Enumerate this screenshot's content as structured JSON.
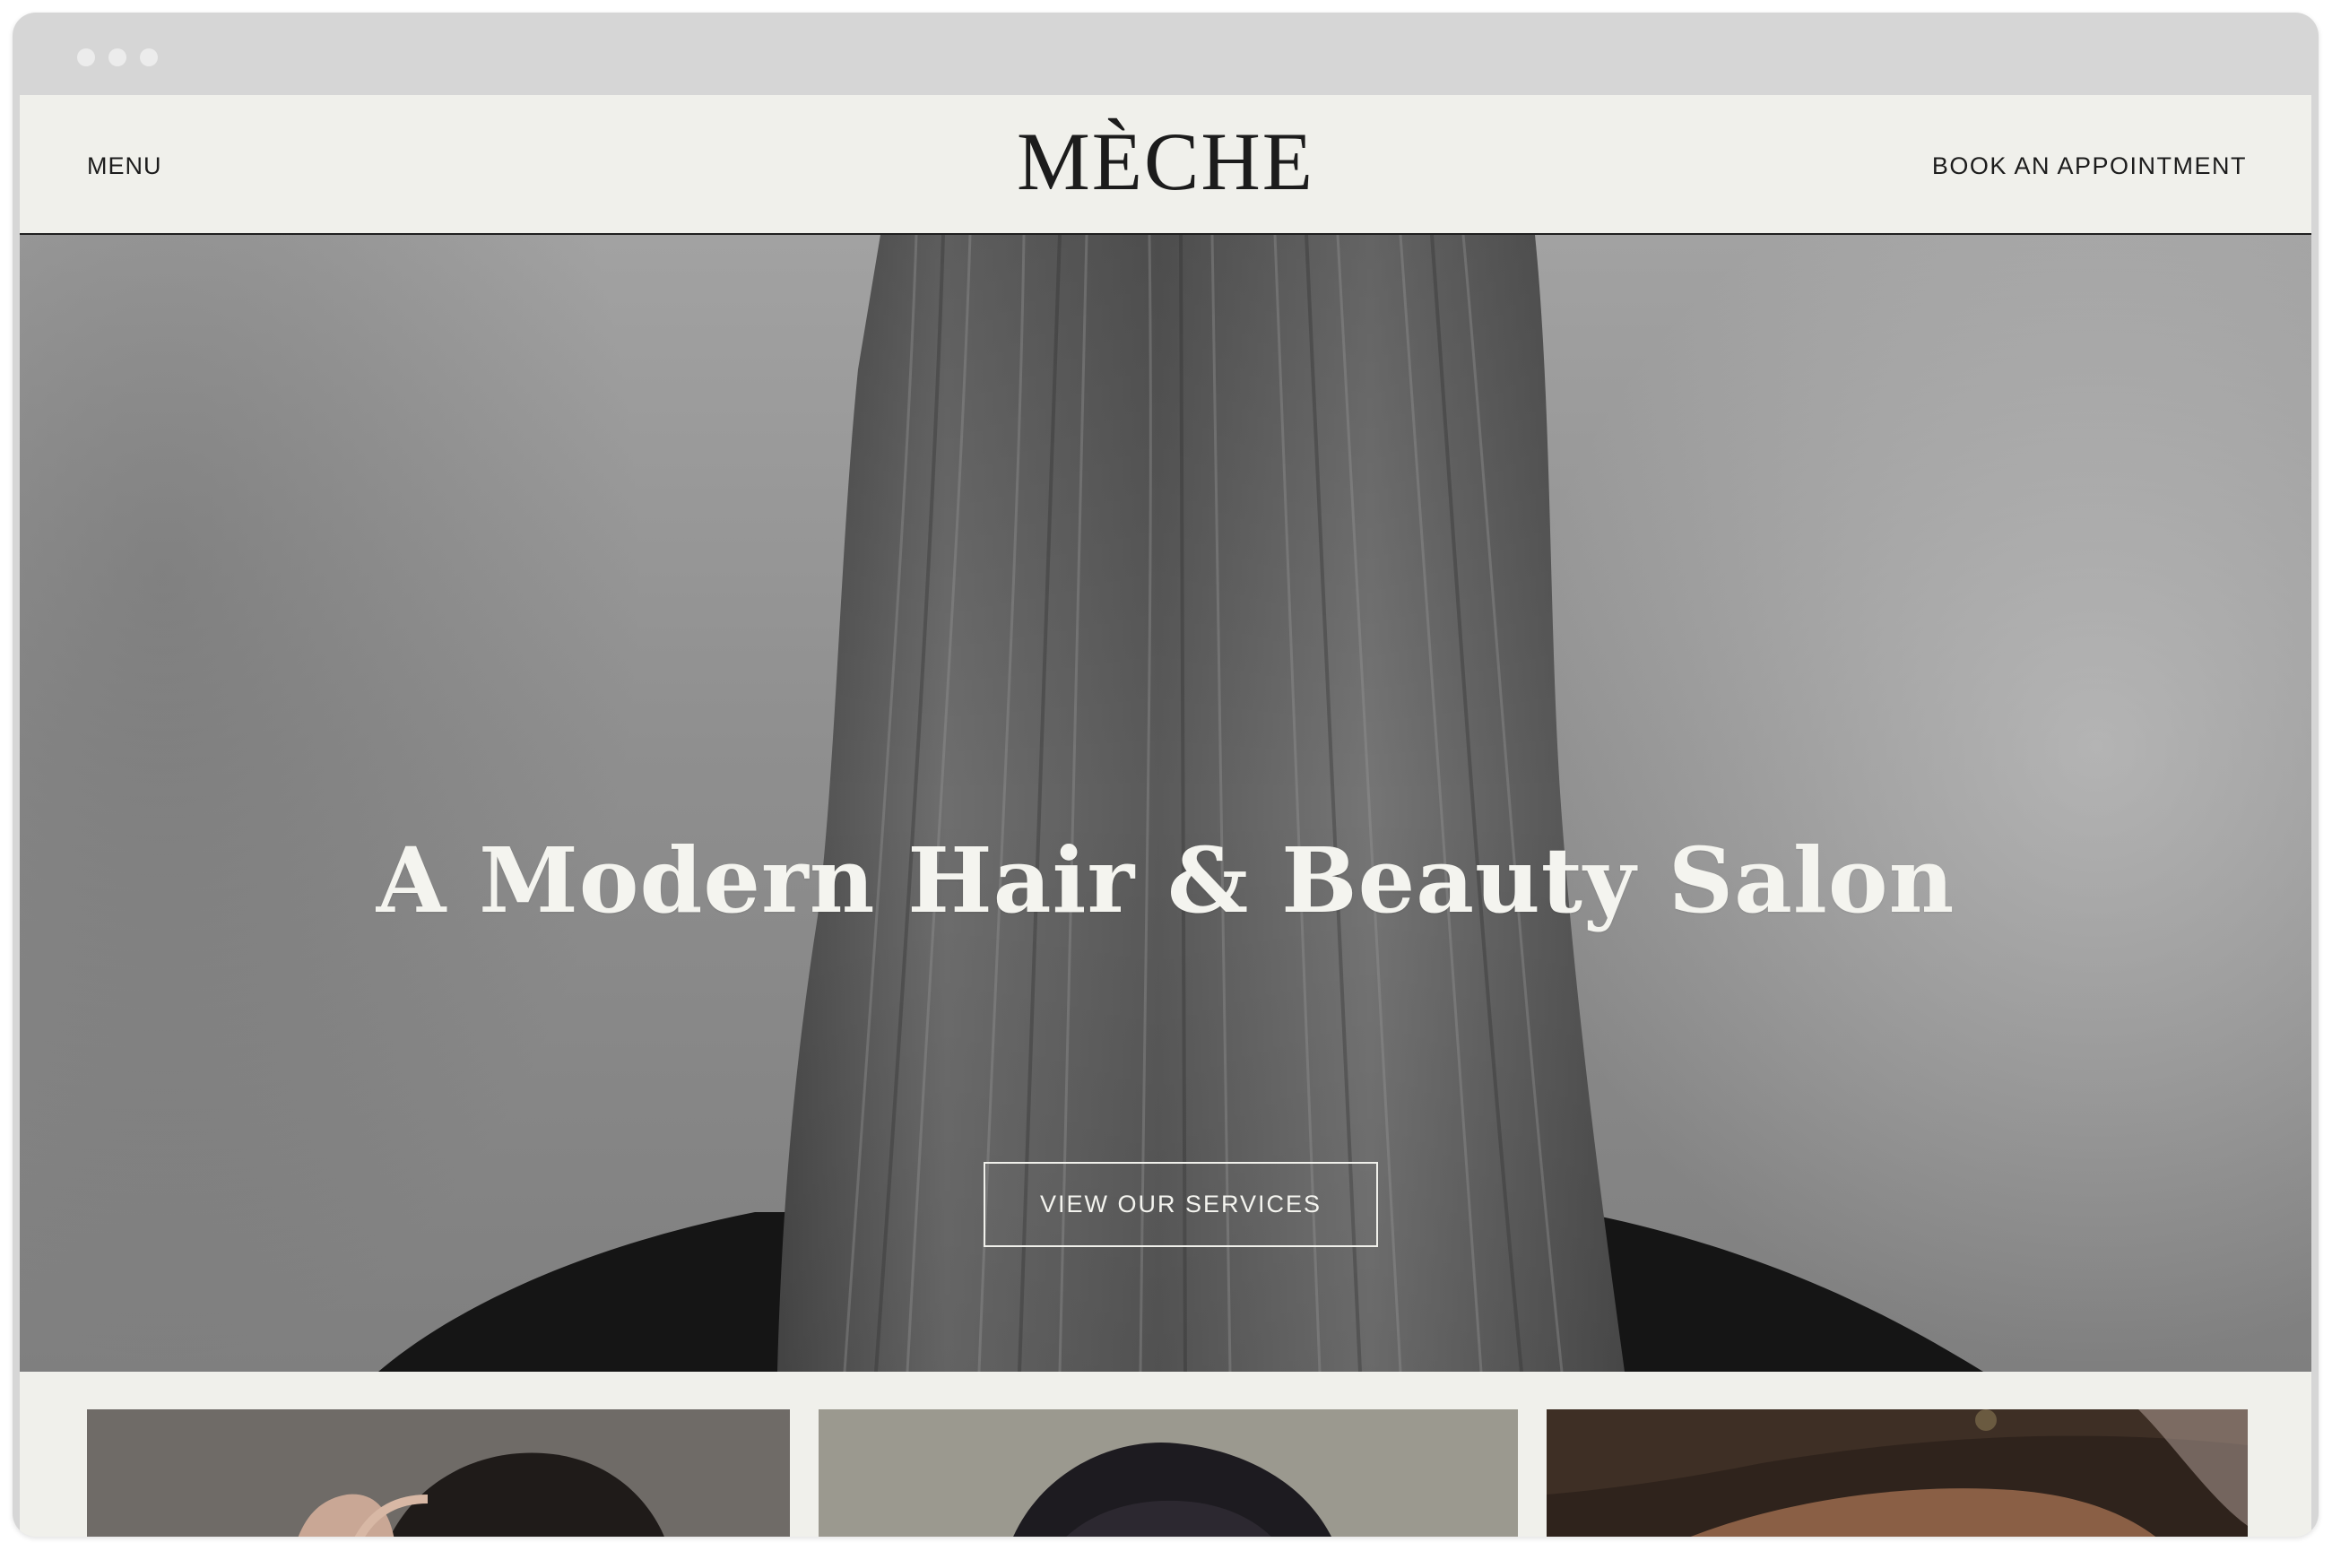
{
  "header": {
    "menu_label": "MENU",
    "logo": "MÈCHE",
    "cta_label": "BOOK AN APPOINTMENT"
  },
  "hero": {
    "title": "A Modern Hair & Beauty Salon",
    "button_label": "VIEW OUR SERVICES"
  },
  "gallery": {
    "tiles": [
      {
        "subject": "woman-touching-hair-photo"
      },
      {
        "subject": "dark-hair-portrait-photo"
      },
      {
        "subject": "woman-with-earring-photo"
      }
    ]
  },
  "colors": {
    "page_background": "#f0f0eb",
    "text_dark": "#1c1c1c",
    "hero_text": "#f4f4ef",
    "browser_chrome": "#d6d6d6"
  }
}
